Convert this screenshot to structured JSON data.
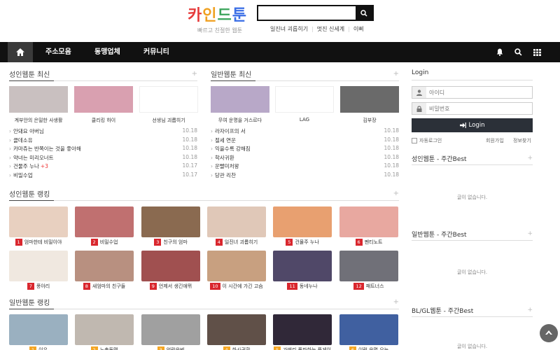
{
  "header": {
    "logo": [
      "카",
      "인",
      "드",
      "툰"
    ],
    "tagline": "빠르고 친절한 웹툰",
    "search_placeholder": "",
    "links": [
      "일진녀 괴롭히기",
      "멋진 신세계",
      "이삐"
    ]
  },
  "nav": {
    "items": [
      "주소모음",
      "동맹업체",
      "커뮤니티"
    ],
    "icons": [
      "home-icon",
      "bell-icon",
      "search-icon",
      "grid-icon"
    ]
  },
  "adult_latest": {
    "title": "성인웹툰 최신",
    "covers": [
      {
        "caption": "계부안의 은밀한 사생활",
        "color": "#c9c0c0"
      },
      {
        "caption": "클리킹 하이",
        "color": "#d9a0b0"
      },
      {
        "caption": "선생님 괴롭히기",
        "color": "#ffffff"
      }
    ],
    "list": [
      {
        "title": "안돼요 아버님",
        "date": "10.18",
        "new": ""
      },
      {
        "title": "클데소유",
        "date": "10.18",
        "new": ""
      },
      {
        "title": "카마쥬는 반쪽이는 것을 좋아해",
        "date": "10.18",
        "new": ""
      },
      {
        "title": "약녀는 미리오너트",
        "date": "10.18",
        "new": ""
      },
      {
        "title": "건물주 누나",
        "date": "10.17",
        "new": "+3"
      },
      {
        "title": "비밀수업",
        "date": "10.17",
        "new": ""
      }
    ]
  },
  "general_latest": {
    "title": "일반웹툰 최신",
    "covers": [
      {
        "caption": "무여 운명을 거스르다",
        "color": "#b8a8c8"
      },
      {
        "caption": "LAG",
        "color": "#ffffff"
      },
      {
        "caption": "김부장",
        "color": "#6a6a6a"
      }
    ],
    "list": [
      {
        "title": "라자이프의 서",
        "date": "10.18",
        "new": ""
      },
      {
        "title": "절세 연운",
        "date": "10.18",
        "new": ""
      },
      {
        "title": "익을수록 강해짐",
        "date": "10.18",
        "new": ""
      },
      {
        "title": "학사귀환",
        "date": "10.18",
        "new": ""
      },
      {
        "title": "운빨미처왕",
        "date": "10.18",
        "new": ""
      },
      {
        "title": "당관 리찬",
        "date": "10.18",
        "new": ""
      }
    ]
  },
  "adult_ranking": {
    "title": "성인웹툰 랭킹",
    "items": [
      {
        "rank": "1",
        "title": "엄마한테 비밀이야",
        "color": "#e8d0c0"
      },
      {
        "rank": "2",
        "title": "비밀수업",
        "color": "#c07070"
      },
      {
        "rank": "3",
        "title": "친구의 엄마",
        "color": "#8a6a50"
      },
      {
        "rank": "4",
        "title": "일진녀 괴롭히기",
        "color": "#e0c8b8"
      },
      {
        "rank": "5",
        "title": "건물주 누나",
        "color": "#e8a070"
      },
      {
        "rank": "6",
        "title": "펜티노트",
        "color": "#e8a8a0"
      },
      {
        "rank": "7",
        "title": "풍아리",
        "color": "#f0e8e0"
      },
      {
        "rank": "8",
        "title": "새엄마의 친구들",
        "color": "#b89080"
      },
      {
        "rank": "9",
        "title": "언제서 생긴애뮈",
        "color": "#a05050"
      },
      {
        "rank": "10",
        "title": "이 시간에 가긴 고슴",
        "color": "#c8a080"
      },
      {
        "rank": "11",
        "title": "동네누나",
        "color": "#504868"
      },
      {
        "rank": "12",
        "title": "패트너스",
        "color": "#707078"
      }
    ]
  },
  "general_ranking": {
    "title": "일반웹툰 랭킹",
    "items": [
      {
        "rank": "1",
        "title": "이우",
        "color": "#9ab0c0"
      },
      {
        "rank": "2",
        "title": "노총동맹",
        "color": "#c0b8b0"
      },
      {
        "rank": "3",
        "title": "언랑운번",
        "color": "#a0a0a0"
      },
      {
        "rank": "4",
        "title": "하사귀환",
        "color": "#605048"
      },
      {
        "rank": "5",
        "title": "가벼리 폭파하는 풍게이",
        "color": "#302838"
      },
      {
        "rank": "6",
        "title": "이런 운명 오는",
        "color": "#4060a0"
      }
    ]
  },
  "login": {
    "title": "Login",
    "id_placeholder": "아이디",
    "pw_placeholder": "비밀번호",
    "button": "Login",
    "auto_login": "자동로그인",
    "join": "회원가입",
    "find": "정보찾기"
  },
  "sidebar": {
    "sections": [
      {
        "title": "성인웹툰 - 주간Best",
        "empty": "글이 없습니다."
      },
      {
        "title": "일반웹툰 - 주간Best",
        "empty": "글이 없습니다."
      },
      {
        "title": "BL/GL웹툰 - 주간Best",
        "empty": "글이 없습니다."
      }
    ]
  }
}
